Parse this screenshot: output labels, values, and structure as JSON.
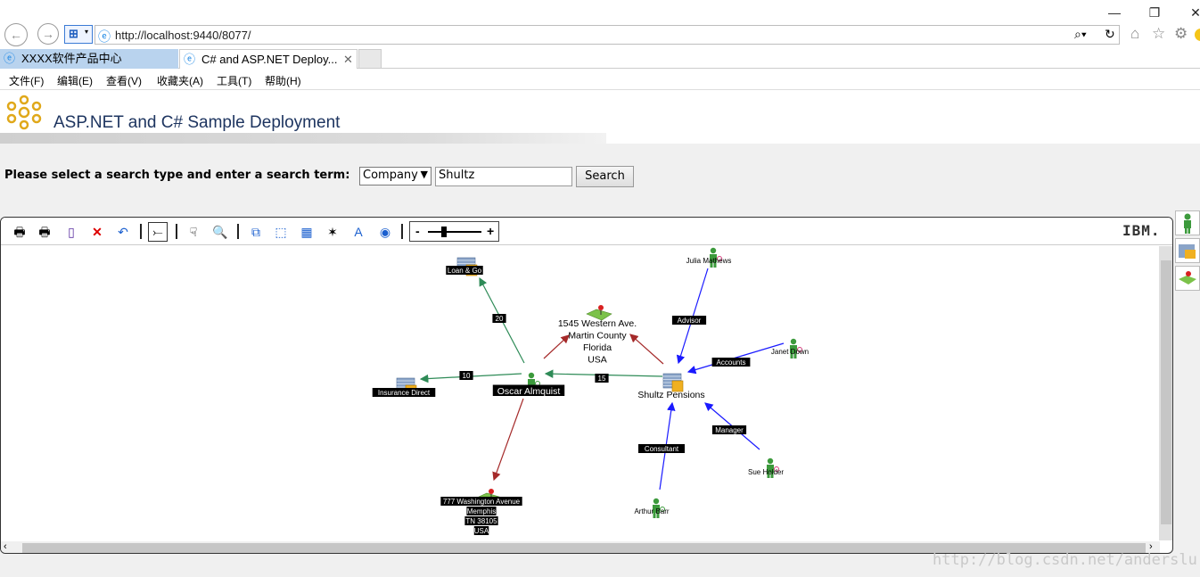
{
  "browser": {
    "url": "http://localhost:9440/8077/",
    "tabs": [
      {
        "label": "XXXX软件产品中心"
      },
      {
        "label": "C# and ASP.NET Deploy..."
      }
    ],
    "menu": [
      "文件(F)",
      "编辑(E)",
      "查看(V)",
      "收藏夹(A)",
      "工具(T)",
      "帮助(H)"
    ],
    "window_controls": {
      "minimize": "—",
      "restore": "❐",
      "close": "✕"
    }
  },
  "page": {
    "title": "ASP.NET and C# Sample Deployment",
    "search_prompt": "Please select a search type and enter a search term:",
    "search_type": "Company",
    "search_term": "Shultz",
    "search_button": "Search"
  },
  "viewer": {
    "brand": "IBM.",
    "zoom_minus": "-",
    "zoom_plus": "+",
    "zoom_level": 0.3
  },
  "graph": {
    "nodes": [
      {
        "id": "loan",
        "kind": "company",
        "label": "Loan & Go"
      },
      {
        "id": "ins",
        "kind": "company",
        "label": "Insurance Direct"
      },
      {
        "id": "oscar",
        "kind": "person",
        "label": "Oscar Almquist"
      },
      {
        "id": "addr1",
        "kind": "address",
        "label": "1545 Western Ave.\nMartin County\nFlorida\nUSA"
      },
      {
        "id": "shultz",
        "kind": "company",
        "label": "Shultz Pensions"
      },
      {
        "id": "addr2",
        "kind": "address",
        "label": "777 Washington Avenue\nMemphis\nTN 38105\nUSA"
      },
      {
        "id": "julia",
        "kind": "person",
        "label": "Julia Mathews"
      },
      {
        "id": "janet",
        "kind": "person",
        "label": "Janet Down"
      },
      {
        "id": "sue",
        "kind": "person",
        "label": "Sue Holder"
      },
      {
        "id": "arthur",
        "kind": "person",
        "label": "Arthur Barr"
      }
    ],
    "edges": [
      {
        "from": "oscar",
        "to": "loan",
        "label": "20",
        "color": "#2e8b57"
      },
      {
        "from": "oscar",
        "to": "ins",
        "label": "10",
        "color": "#2e8b57"
      },
      {
        "from": "oscar",
        "to": "shultz",
        "label": "15",
        "color": "#2e8b57"
      },
      {
        "from": "oscar",
        "to": "addr1",
        "label": "",
        "color": "#a52a2a"
      },
      {
        "from": "oscar",
        "to": "addr2",
        "label": "",
        "color": "#a52a2a"
      },
      {
        "from": "shultz",
        "to": "addr1",
        "label": "",
        "color": "#a52a2a"
      },
      {
        "from": "julia",
        "to": "shultz",
        "label": "Advisor",
        "color": "#1a1aff"
      },
      {
        "from": "janet",
        "to": "shultz",
        "label": "Accounts",
        "color": "#1a1aff"
      },
      {
        "from": "sue",
        "to": "shultz",
        "label": "Manager",
        "color": "#1a1aff"
      },
      {
        "from": "arthur",
        "to": "shultz",
        "label": "Consultant",
        "color": "#1a1aff"
      }
    ]
  },
  "watermark": "http://blog.csdn.net/anderslu"
}
